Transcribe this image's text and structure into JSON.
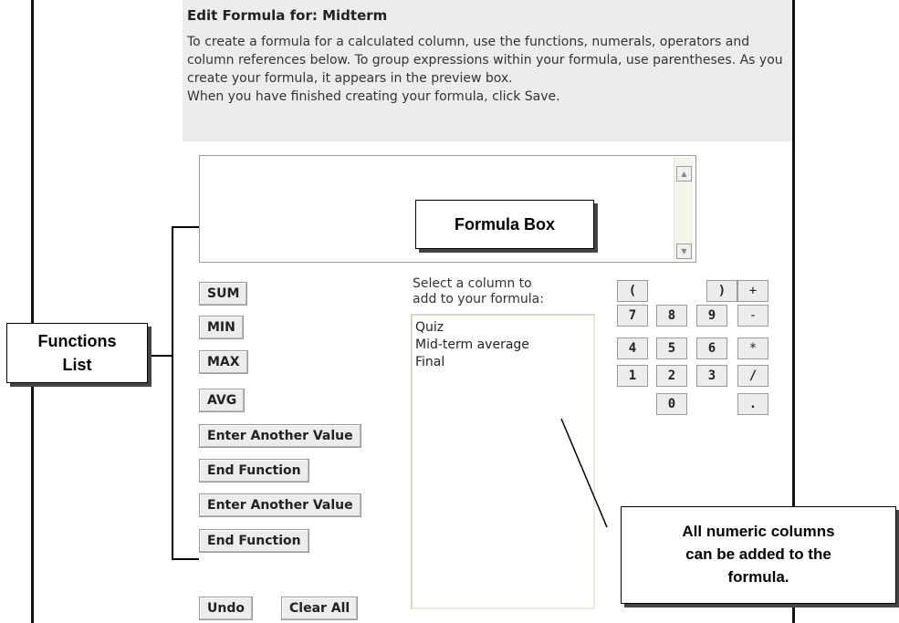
{
  "header": {
    "title": "Edit Formula for: Midterm",
    "description": "To create a formula for a calculated column, use the functions, numerals, operators and column references below. To group expressions within your formula, use parentheses. As you create your formula, it appears in the preview box.",
    "instruction": "When you have finished creating your formula, click Save."
  },
  "formula_box": {
    "value": "",
    "scroll_up_icon": "arrow-up-icon",
    "scroll_down_icon": "arrow-down-icon"
  },
  "callouts": {
    "formula_box": "Formula Box",
    "functions_list_line1": "Functions",
    "functions_list_line2": "List",
    "numeric_line1": "All numeric columns",
    "numeric_line2": "can be added to the",
    "numeric_line3": "formula."
  },
  "functions": {
    "sum": "SUM",
    "min": "MIN",
    "max": "MAX",
    "avg": "AVG",
    "enter_another_value_1": "Enter Another Value",
    "end_function_1": "End Function",
    "enter_another_value_2": "Enter Another Value",
    "end_function_2": "End Function"
  },
  "columns": {
    "label_line1": "Select a column to",
    "label_line2": "add to your formula:",
    "items": [
      "Quiz",
      "Mid-term average",
      "Final"
    ]
  },
  "keypad": {
    "open_paren": "(",
    "close_paren": ")",
    "plus": "+",
    "seven": "7",
    "eight": "8",
    "nine": "9",
    "minus": "-",
    "four": "4",
    "five": "5",
    "six": "6",
    "multiply": "*",
    "one": "1",
    "two": "2",
    "three": "3",
    "divide": "/",
    "zero": "0",
    "decimal": "."
  },
  "actions": {
    "undo": "Undo",
    "clear_all": "Clear All"
  }
}
